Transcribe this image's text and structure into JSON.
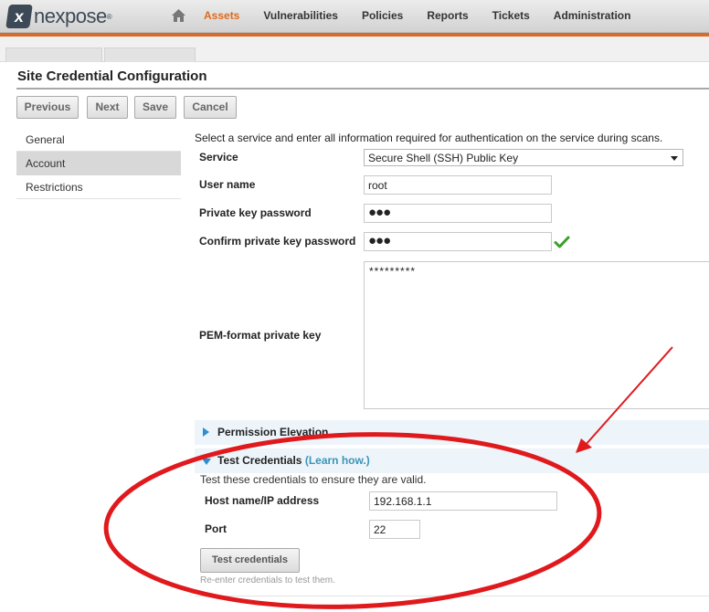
{
  "brand": {
    "name": "nexpose",
    "reg": "®"
  },
  "nav": {
    "items": [
      {
        "label": "Assets",
        "active": true
      },
      {
        "label": "Vulnerabilities",
        "active": false
      },
      {
        "label": "Policies",
        "active": false
      },
      {
        "label": "Reports",
        "active": false
      },
      {
        "label": "Tickets",
        "active": false
      },
      {
        "label": "Administration",
        "active": false
      }
    ]
  },
  "page": {
    "title": "Site Credential Configuration"
  },
  "toolbar": {
    "previous": "Previous",
    "next": "Next",
    "save": "Save",
    "cancel": "Cancel"
  },
  "sidebar": {
    "items": [
      {
        "label": "General",
        "active": false
      },
      {
        "label": "Account",
        "active": true
      },
      {
        "label": "Restrictions",
        "active": false
      }
    ]
  },
  "form": {
    "intro": "Select a service and enter all information required for authentication on the service during scans.",
    "service_label": "Service",
    "service_value": "Secure Shell (SSH) Public Key",
    "username_label": "User name",
    "username_value": "root",
    "private_key_password_label": "Private key password",
    "private_key_password_value": "●●●",
    "confirm_label": "Confirm private key password",
    "confirm_value": "●●●",
    "pem_label": "PEM-format private key",
    "pem_value": "*********"
  },
  "permission_elevation": {
    "title": "Permission Elevation"
  },
  "test_credentials": {
    "title": "Test Credentials",
    "learn": "(Learn how.)",
    "intro": "Test these credentials to ensure they are valid.",
    "host_label": "Host name/IP address",
    "host_value": "192.168.1.1",
    "port_label": "Port",
    "port_value": "22",
    "button": "Test credentials",
    "hint": "Re-enter credentials to test them."
  },
  "colors": {
    "accent": "#e06a1b",
    "annotation": "#e0191d",
    "link": "#3a95b8",
    "panel": "#edf4fa"
  },
  "icons": [
    "home-icon",
    "check-icon",
    "expand-arrow-icon",
    "collapse-arrow-icon",
    "select-arrow-icon"
  ]
}
